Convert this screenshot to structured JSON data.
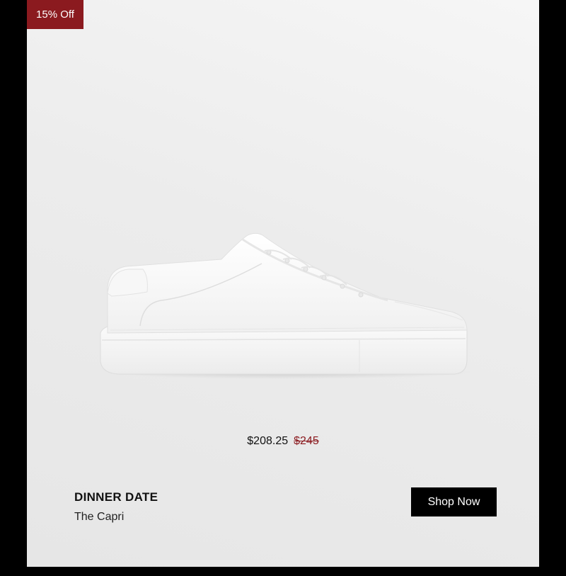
{
  "badge": {
    "label": "15% Off"
  },
  "pricing": {
    "current": "$208.25",
    "original": "$245"
  },
  "product": {
    "collection": "DINNER DATE",
    "name": "The Capri"
  },
  "cta": {
    "label": "Shop Now"
  },
  "colors": {
    "badge_bg": "#8b1a1f",
    "sale_price": "#8b1a1f",
    "button_bg": "#000000",
    "button_text": "#ffffff"
  },
  "image": {
    "subject": "white-leather-low-top-sneaker-icon"
  }
}
